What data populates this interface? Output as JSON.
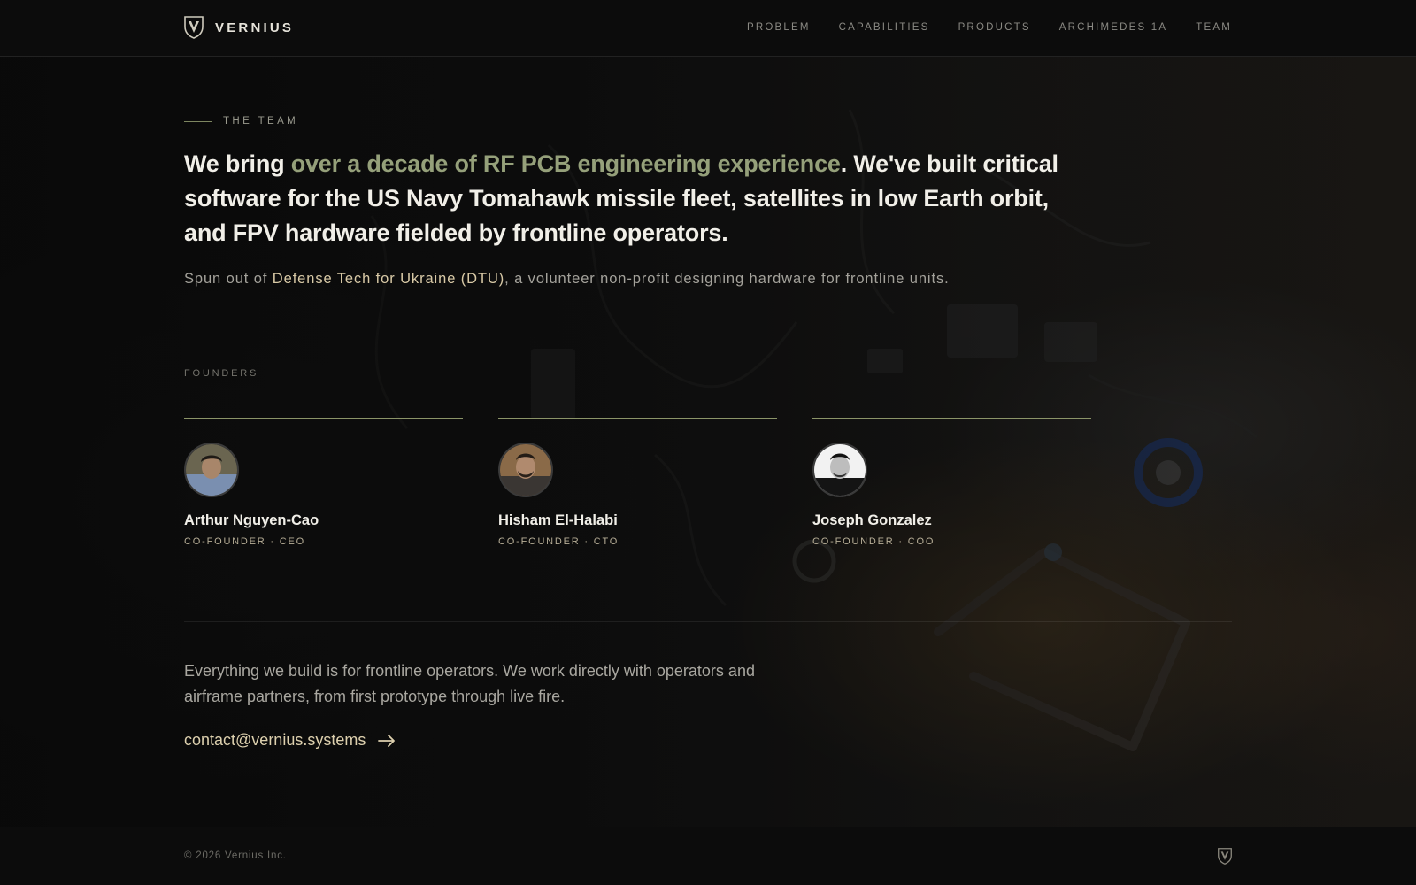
{
  "header": {
    "brand": "VERNIUS",
    "nav": [
      "PROBLEM",
      "CAPABILITIES",
      "PRODUCTS",
      "ARCHIMEDES 1A",
      "TEAM"
    ]
  },
  "team": {
    "eyebrow": "THE TEAM",
    "headline_parts": {
      "lead": "We bring ",
      "highlight": "over a decade of RF PCB engineering experience",
      "rest": ". We've built critical software for the US Navy Tomahawk missile fleet, satellites in low Earth orbit, and FPV hardware fielded by frontline operators."
    },
    "sub_parts": {
      "lead": "Spun out of ",
      "org": "Defense Tech for Ukraine (DTU)",
      "rest": ", a volunteer non-profit designing hardware for frontline units."
    },
    "founders_label": "FOUNDERS",
    "founders": [
      {
        "name": "Arthur Nguyen-Cao",
        "role": "CO-FOUNDER · CEO"
      },
      {
        "name": "Hisham El-Halabi",
        "role": "CO-FOUNDER · CTO"
      },
      {
        "name": "Joseph Gonzalez",
        "role": "CO-FOUNDER · COO"
      }
    ],
    "closing": "Everything we build is for frontline operators. We work directly with operators and airframe partners, from first prototype through live fire.",
    "contact_email": "contact@vernius.systems"
  },
  "footer": {
    "copyright": "© 2026 Vernius Inc."
  },
  "colors": {
    "accent_olive": "#95a07a",
    "accent_sand": "#d8c9a6",
    "background": "#0b0b0b"
  }
}
